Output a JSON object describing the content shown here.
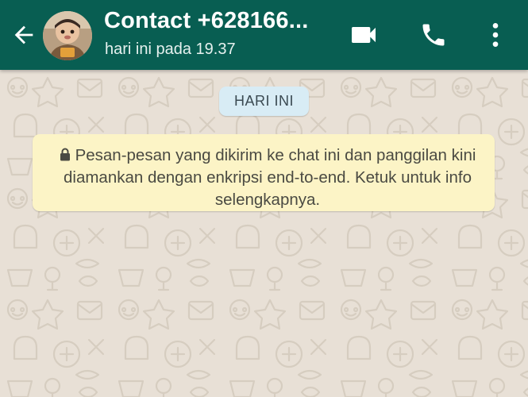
{
  "header": {
    "contact_name": "Contact +628166...",
    "last_seen": "hari ini pada 19.37",
    "icons": {
      "back": "arrow-back-icon",
      "video": "videocam-icon",
      "call": "phone-icon",
      "menu": "more-vert-icon"
    },
    "colors": {
      "header_bg": "#085e52",
      "text": "#ffffff"
    }
  },
  "chat": {
    "date_chip": "HARI INI",
    "encryption_notice": "Pesan-pesan yang dikirim ke chat ini dan panggilan kini diamankan dengan enkripsi end-to-end. Ketuk untuk info selengkapnya.",
    "colors": {
      "wallpaper": "#e8e0d6",
      "date_chip_bg": "#d8ecf5",
      "notice_bg": "#fcf4c6"
    }
  }
}
